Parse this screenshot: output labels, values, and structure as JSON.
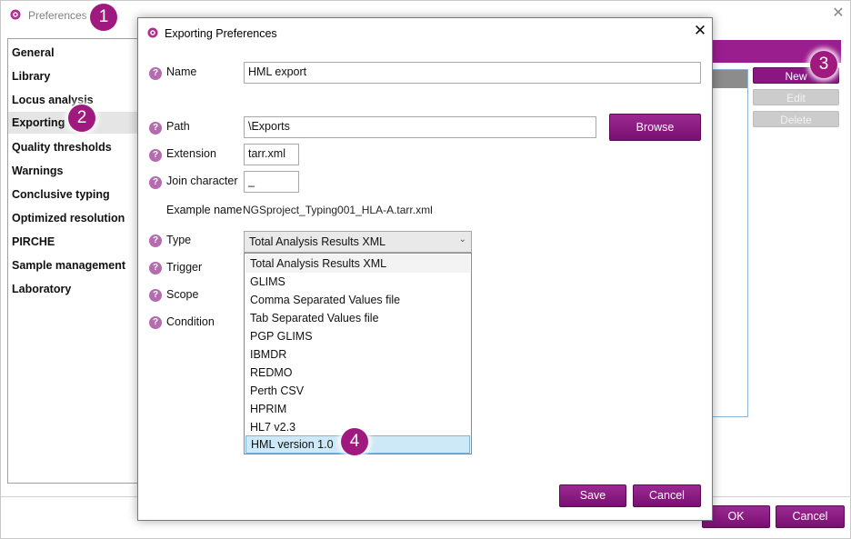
{
  "outer_window": {
    "title": "Preferences",
    "close_glyph": "✕",
    "app_icon": "gear-icon"
  },
  "nav": {
    "items": [
      {
        "label": "General"
      },
      {
        "label": "Library"
      },
      {
        "label": "Locus analysis"
      },
      {
        "label": "Exporting",
        "selected": true
      },
      {
        "label": "Quality thresholds"
      },
      {
        "label": "Warnings"
      },
      {
        "label": "Conclusive typing"
      },
      {
        "label": "Optimized resolution"
      },
      {
        "label": "PIRCHE"
      },
      {
        "label": "Sample management"
      },
      {
        "label": "Laboratory"
      }
    ]
  },
  "side_buttons": {
    "new": "New",
    "edit": "Edit",
    "delete": "Delete"
  },
  "outer_footer": {
    "ok": "OK",
    "cancel": "Cancel"
  },
  "dialog": {
    "title": "Exporting Preferences",
    "close_glyph": "✕",
    "help_glyph": "?",
    "fields": {
      "name": {
        "label": "Name",
        "value": "HML export"
      },
      "path": {
        "label": "Path",
        "value": "\\Exports"
      },
      "browse": "Browse",
      "extension": {
        "label": "Extension",
        "value": "tarr.xml"
      },
      "join_character": {
        "label": "Join character",
        "value": "_"
      },
      "example_name": {
        "label": "Example name",
        "value": "NGSproject_Typing001_HLA-A.tarr.xml"
      },
      "type": {
        "label": "Type",
        "value": "Total Analysis Results XML"
      },
      "trigger": {
        "label": "Trigger"
      },
      "scope": {
        "label": "Scope"
      },
      "condition": {
        "label": "Condition"
      }
    },
    "type_options": [
      "Total Analysis Results XML",
      "GLIMS",
      "Comma Separated Values file",
      "Tab Separated Values file",
      "PGP GLIMS",
      "IBMDR",
      "REDMO",
      "Perth CSV",
      "HPRIM",
      "HL7 v2.3",
      "HML version 1.0"
    ],
    "highlighted_option": "HML version 1.0",
    "save": "Save",
    "cancel": "Cancel"
  },
  "callouts": [
    "1",
    "2",
    "3",
    "4"
  ],
  "colors": {
    "accent": "#9b1e8f",
    "badge": "#a0197f",
    "highlight": "#cde8f7"
  }
}
